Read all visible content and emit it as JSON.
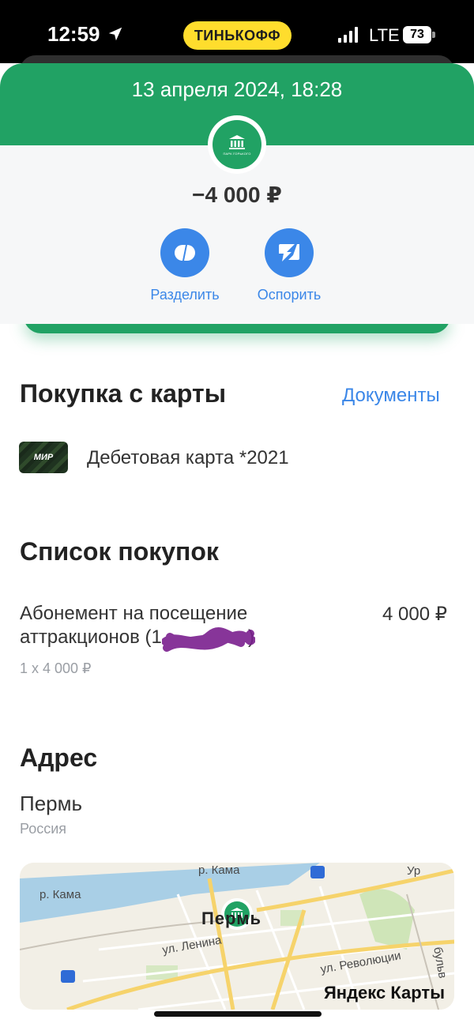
{
  "status_bar": {
    "time": "12:59",
    "carrier_badge": "ТИНЬКОФФ",
    "network": "LTE",
    "battery": "73"
  },
  "header": {
    "date": "13 апреля 2024, 18:28",
    "amount": "−4 000 ₽",
    "merchant_logo_icon": "park-building-icon",
    "actions": [
      {
        "label": "Разделить",
        "icon": "split-icon"
      },
      {
        "label": "Оспорить",
        "icon": "dispute-icon"
      }
    ]
  },
  "purchase": {
    "title": "Покупка с карты",
    "documents_link": "Документы",
    "card_brand": "МИР",
    "card_label": "Дебетовая карта *2021"
  },
  "purchase_list": {
    "title": "Список покупок",
    "items": [
      {
        "name_line1": "Абонемент на посещение",
        "name_line2": "аттракционов (1",
        "name_line2_end": ")",
        "price": "4 000 ₽",
        "quantity": "1 x 4 000 ₽"
      }
    ]
  },
  "address": {
    "title": "Адрес",
    "city": "Пермь",
    "country": "Россия"
  },
  "map": {
    "labels": {
      "river_1": "р. Кама",
      "river_2": "р. Кама",
      "street_1": "ул. Ленина",
      "street_2": "ул. Революции",
      "street_3": "Ур",
      "street_4": "бульв",
      "city": "Пермь"
    },
    "brand": "Яндекс Карты"
  },
  "colors": {
    "brand_green": "#21a264",
    "accent_blue": "#3b87e8",
    "tinkoff_yellow": "#ffdd2d"
  }
}
